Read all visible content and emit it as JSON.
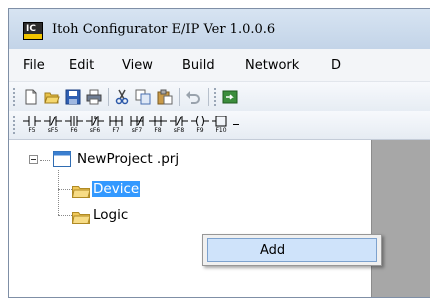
{
  "window": {
    "title": "Itoh Configurator E/IP Ver 1.0.0.6"
  },
  "menu": [
    "File",
    "Edit",
    "View",
    "Build",
    "Network",
    "D"
  ],
  "toolbar": {
    "buttons": [
      "new-file-icon",
      "open-folder-icon",
      "save-icon",
      "print-icon",
      "cut-icon",
      "copy-icon",
      "paste-icon",
      "undo-icon",
      "build-icon"
    ]
  },
  "fkeys": [
    "F5",
    "sF5",
    "F6",
    "sF6",
    "F7",
    "sF7",
    "F8",
    "sF8",
    "F9",
    "F10"
  ],
  "tree": {
    "project": "NewProject .prj",
    "children": [
      "Device",
      "Logic"
    ],
    "selected": "Device"
  },
  "context_menu": {
    "items": [
      "Add"
    ]
  },
  "colors": {
    "selection": "#3399ff",
    "menu_hover": "#cfe3fa",
    "workspace": "#a7a7a7"
  }
}
